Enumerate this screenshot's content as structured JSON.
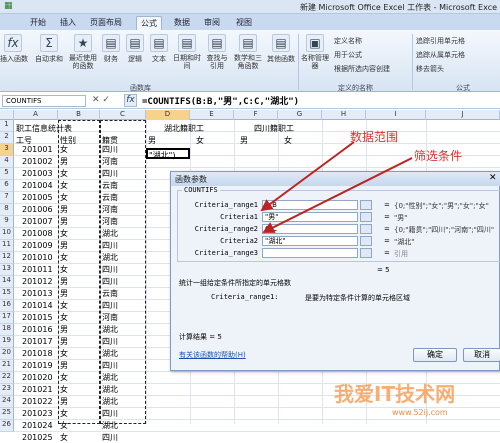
{
  "window": {
    "title": "新建 Microsoft Office Excel 工作表 - Microsoft Exce"
  },
  "tabs": [
    "开始",
    "插入",
    "页面布局",
    "公式",
    "数据",
    "审阅",
    "视图"
  ],
  "ribbon": {
    "insert_fn": "插入函数",
    "autosum": "自动求和",
    "recent": "最近使用的函数",
    "finance": "财务",
    "logic": "逻辑",
    "text": "文本",
    "datetime": "日期和时间",
    "lookup": "查找与引用",
    "math": "数学和三角函数",
    "other": "其他函数",
    "lib_group": "函数库",
    "name_mgr": "名称管理器",
    "define_name": "定义名称",
    "use_in_formula": "用于公式",
    "create_from_sel": "根据所选内容创建",
    "names_group": "定义的名称",
    "trace_prec": "追踪引用单元格",
    "trace_dep": "追踪从属单元格",
    "remove_arrows": "移去箭头",
    "formula_audit": "公式"
  },
  "formula_bar": {
    "name_box": "COUNTIFS",
    "formula": "=COUNTIFS(B:B,\"男\",C:C,\"湖北\")"
  },
  "columns": [
    "A",
    "B",
    "C",
    "D",
    "E",
    "F",
    "G",
    "H",
    "I",
    "J"
  ],
  "sheet": {
    "a1": "职工信息统计表",
    "d1": "湖北籍职工",
    "f1": "四川籍职工",
    "headers": [
      "工号",
      "性别",
      "籍贯"
    ],
    "d2": "男",
    "e2": "女",
    "f2": "男",
    "g2": "女",
    "d3": "\"湖北\")",
    "rows": [
      [
        "201001",
        "女",
        "四川"
      ],
      [
        "201002",
        "男",
        "河南"
      ],
      [
        "201003",
        "女",
        "四川"
      ],
      [
        "201004",
        "女",
        "云南"
      ],
      [
        "201005",
        "女",
        "云南"
      ],
      [
        "201006",
        "男",
        "河南"
      ],
      [
        "201007",
        "男",
        "河南"
      ],
      [
        "201008",
        "女",
        "湖北"
      ],
      [
        "201009",
        "男",
        "四川"
      ],
      [
        "201010",
        "女",
        "湖北"
      ],
      [
        "201011",
        "女",
        "四川"
      ],
      [
        "201012",
        "男",
        "四川"
      ],
      [
        "201013",
        "男",
        "云南"
      ],
      [
        "201014",
        "女",
        "四川"
      ],
      [
        "201015",
        "女",
        "河南"
      ],
      [
        "201016",
        "男",
        "湖北"
      ],
      [
        "201017",
        "男",
        "四川"
      ],
      [
        "201018",
        "女",
        "湖北"
      ],
      [
        "201019",
        "男",
        "四川"
      ],
      [
        "201020",
        "女",
        "湖北"
      ],
      [
        "201021",
        "女",
        "湖北"
      ],
      [
        "201022",
        "男",
        "湖北"
      ],
      [
        "201023",
        "女",
        "四川"
      ],
      [
        "201024",
        "女",
        "湖北"
      ],
      [
        "201025",
        "女",
        "四川"
      ]
    ]
  },
  "annotations": {
    "range": "数据范围",
    "filter": "筛选条件"
  },
  "dialog": {
    "title": "函数参数",
    "fn": "COUNTIFS",
    "args": [
      {
        "label": "Criteria_range1",
        "value": "B:B",
        "result": "{0;\"性别\";\"女\";\"男\";\"女\";\"女\""
      },
      {
        "label": "Criteria1",
        "value": "\"男\"",
        "result": "\"男\""
      },
      {
        "label": "Criteria_range2",
        "value": "C:C",
        "result": "{0;\"籍贯\";\"四川\";\"河南\";\"四川\""
      },
      {
        "label": "Criteria2",
        "value": "\"湖北\"",
        "result": "\"湖北\""
      },
      {
        "label": "Criteria_range3",
        "value": "",
        "result": "引用"
      }
    ],
    "total": "= 5",
    "desc": "统计一组给定条件所指定的单元格数",
    "arg_desc_label": "Criteria_range1:",
    "arg_desc": "是要为特定条件计算的单元格区域",
    "calc_result": "计算结果 = 5",
    "help": "有关该函数的帮助(H)",
    "ok": "确定",
    "cancel": "取消"
  },
  "watermark": {
    "text": "我爱IT技术网",
    "url": "www.52ij.com"
  }
}
